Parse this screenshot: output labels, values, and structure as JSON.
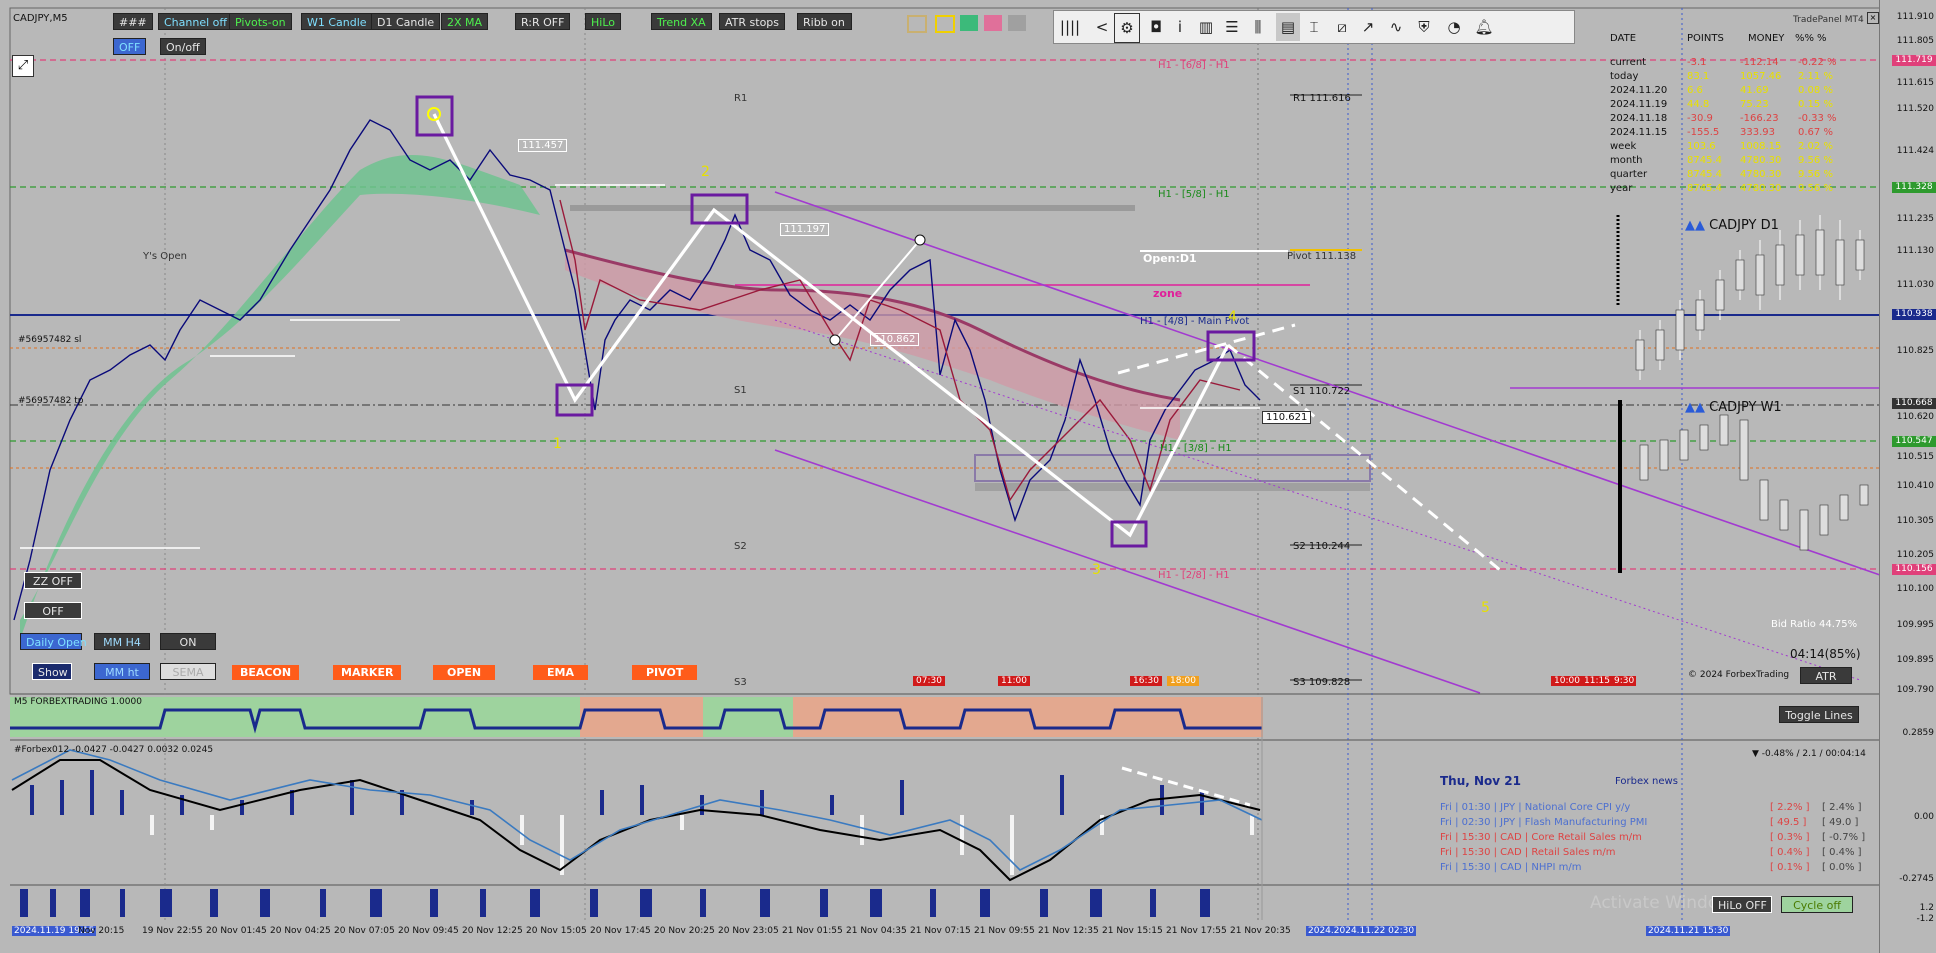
{
  "symbol": "CADJPY,M5",
  "toolbar_row1": [
    "###",
    "Channel off",
    "Pivots-on",
    "W1 Candle",
    "D1 Candle",
    "2X MA",
    "R:R OFF",
    "HiLo",
    "Trend XA",
    "ATR stops",
    "Ribb on"
  ],
  "toolbar_row2": [
    "OFF",
    "On/off"
  ],
  "left_buttons": {
    "zz_off": "ZZ OFF",
    "off": "OFF",
    "daily_open": "Daily Open",
    "mm_h4": "MM H4",
    "on": "ON",
    "show": "Show",
    "mm_ht": "MM ht",
    "sema": "SEMA"
  },
  "orange_buttons": [
    "BEACON",
    "MARKER",
    "OPEN",
    "EMA",
    "PIVOT"
  ],
  "tradepanel_title": "TradePanel MT4",
  "pm_headers": [
    "DATE",
    "POINTS",
    "MONEY",
    "%%",
    "%"
  ],
  "pm_rows": [
    {
      "date": "current",
      "points": "-3.1",
      "money": "-112.14",
      "pct": "-0.22 %"
    },
    {
      "date": "today",
      "points": "83.1",
      "money": "1057.46",
      "pct": "2.11 %"
    },
    {
      "date": "2024.11.20",
      "points": "6.6",
      "money": "41.69",
      "pct": "0.08 %"
    },
    {
      "date": "2024.11.19",
      "points": "44.8",
      "money": "75.23",
      "pct": "0.15 %"
    },
    {
      "date": "2024.11.18",
      "points": "-30.9",
      "money": "-166.23",
      "pct": "-0.33 %"
    },
    {
      "date": "2024.11.15",
      "points": "-155.5",
      "money": "333.93",
      "pct": "0.67 %"
    },
    {
      "date": "week",
      "points": "103.6",
      "money": "1008.15",
      "pct": "2.02 %"
    },
    {
      "date": "month",
      "points": "8745.4",
      "money": "4780.30",
      "pct": "9.56 %"
    },
    {
      "date": "quarter",
      "points": "8745.4",
      "money": "4780.30",
      "pct": "9.56 %"
    },
    {
      "date": "year",
      "points": "8745.4",
      "money": "4780.30",
      "pct": "9.56 %"
    }
  ],
  "mini_d1": "CADJPY D1",
  "mini_w1": "CADJPY W1",
  "bid_ratio": "Bid Ratio 44.75%",
  "timer": "04:14(85%)",
  "copyright": "© 2024 ForbexTrading",
  "atr_button": "ATR",
  "toggle_lines": "Toggle Lines",
  "price_axis": [
    "111.910",
    "111.805",
    "111.719",
    "111.615",
    "111.520",
    "111.424",
    "111.328",
    "111.235",
    "111.130",
    "111.030",
    "110.938",
    "110.825",
    "110.668",
    "110.620",
    "110.547",
    "110.515",
    "110.410",
    "110.305",
    "110.205",
    "110.156",
    "110.100",
    "109.995",
    "109.895",
    "109.790"
  ],
  "pivots": {
    "r1": "R1 111.616",
    "pivot": "Pivot 111.138",
    "s1": "S1 110.722",
    "s2": "S2 110.244",
    "s3": "S3 109.828",
    "r1_short": "R1",
    "s1_short": "S1",
    "s2_short": "S2",
    "s3_short": "S3"
  },
  "murray": {
    "h68": "H1 - [6/8] - H1",
    "h58": "H1 - [5/8] - H1",
    "h48": "H1 - [4/8] - Main Pivot",
    "h38": "H1 - [3/8] - H1",
    "h28": "H1 - [2/8] - H1"
  },
  "chart_labels": {
    "open_d1": "Open:D1",
    "zone": "zone",
    "ys_open": "Y's Open",
    "wave1": "1",
    "wave2": "2",
    "wave3": "3",
    "wave4": "4",
    "wave5": "5",
    "price_now": "110.621",
    "p1": "111.457",
    "p2": "111.197",
    "p3": "110.862",
    "order1": "#56957482 sl",
    "order2": "#56957482 tp"
  },
  "session_marks": [
    "07:30",
    "11:00",
    "16:30",
    "18:00",
    "10:00",
    "11:15",
    "9:30"
  ],
  "ind1_label": "M5 FORBEXTRADING 1.0000",
  "ind2_label": "#Forbex012 -0.0427 -0.0427 0.0032 0.0245",
  "ind2_axis": [
    "0.2859",
    "0.00",
    "-0.2745"
  ],
  "ind3_axis": [
    "1.2",
    "-1.2"
  ],
  "ind_change": "▼ -0.48% / 2.1 / 00:04:14",
  "news": {
    "date": "Thu, Nov 21",
    "title": "Forbex news",
    "items": [
      {
        "text": "Fri  |  01:30  |  JPY  |  National Core CPI y/y",
        "val1": "[ 2.2% ]",
        "val2": "[ 2.4% ]",
        "color": "#4c6fd0"
      },
      {
        "text": "Fri  |  02:30  |  JPY  |  Flash Manufacturing PMI",
        "val1": "[ 49.5 ]",
        "val2": "[ 49.0 ]",
        "color": "#4c6fd0"
      },
      {
        "text": "Fri  |  15:30  |  CAD  |  Core Retail Sales m/m",
        "val1": "[ 0.3% ]",
        "val2": "[ -0.7% ]",
        "color": "#d44"
      },
      {
        "text": "Fri  |  15:30  |  CAD  |  Retail Sales m/m",
        "val1": "[ 0.4% ]",
        "val2": "[ 0.4% ]",
        "color": "#d44"
      },
      {
        "text": "Fri  |  15:30  |  CAD  |  NHPI m/m",
        "val1": "[ 0.1% ]",
        "val2": "[ 0.0% ]",
        "color": "#4c6fd0"
      }
    ]
  },
  "bottom_buttons": {
    "hilo_off": "HiLo OFF",
    "cycle_off": "Cycle off"
  },
  "watermark": "Activate Windows",
  "time_axis": [
    "2024.11.19 19:15",
    "Nov 20:15",
    "19 Nov 22:55",
    "20 Nov 01:45",
    "20 Nov 04:25",
    "20 Nov 07:05",
    "20 Nov 09:45",
    "20 Nov 12:25",
    "20 Nov 15:05",
    "20 Nov 17:45",
    "20 Nov 20:25",
    "20 Nov 23:05",
    "21 Nov 01:55",
    "21 Nov 04:35",
    "21 Nov 07:15",
    "21 Nov 09:55",
    "21 Nov 12:35",
    "21 Nov 15:15",
    "21 Nov 17:55",
    "21 Nov 20:35"
  ],
  "time_marker": "2024.2024.11.22 02:30",
  "time_marker2": "2024.11.21 15:30"
}
